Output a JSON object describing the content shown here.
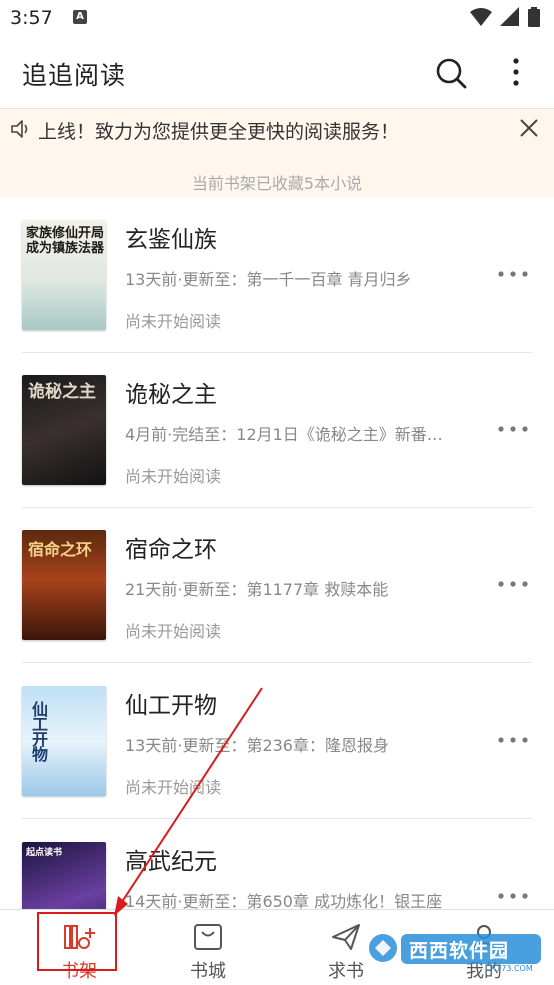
{
  "status_bar": {
    "time": "3:57",
    "badge": "A"
  },
  "app_bar": {
    "title": "追追阅读",
    "search_icon": "search-icon",
    "more_icon": "more-vert-icon"
  },
  "notice": {
    "text": "上线！致力为您提供更全更快的阅读服务！",
    "speaker_icon": "speaker-icon",
    "close_icon": "close-icon"
  },
  "shelf_count_text": "当前书架已收藏5本小说",
  "books": [
    {
      "title": "玄鉴仙族",
      "latest": "13天前·更新至：第一千一百章 青月归乡",
      "progress": "尚未开始阅读",
      "cover_text": "家族修仙开局成为镇族法器"
    },
    {
      "title": "诡秘之主",
      "latest": "4月前·完结至：12月1日《诡秘之主》新番…",
      "progress": "尚未开始阅读",
      "cover_text": "诡秘之主"
    },
    {
      "title": "宿命之环",
      "latest": "21天前·更新至：第1177章 救赎本能",
      "progress": "尚未开始阅读",
      "cover_text": "宿命之环"
    },
    {
      "title": "仙工开物",
      "latest": "13天前·更新至：第236章：隆恩报身",
      "progress": "尚未开始阅读",
      "cover_text": "仙工开物"
    },
    {
      "title": "高武纪元",
      "latest": "14天前·更新至：第650章 成功炼化！银王座",
      "progress": "",
      "cover_text": "起点读书"
    }
  ],
  "bottom_nav": [
    {
      "label": "书架",
      "icon": "bookshelf-icon",
      "active": true
    },
    {
      "label": "书城",
      "icon": "store-bag-icon",
      "active": false
    },
    {
      "label": "求书",
      "icon": "send-request-icon",
      "active": false
    },
    {
      "label": "我的",
      "icon": "profile-icon",
      "active": false
    }
  ],
  "watermark": {
    "text": "西西软件园",
    "sub": "CR173.COM"
  },
  "colors": {
    "accent": "#d93a2b",
    "annotation": "#d81c1c",
    "notice_bg": "#fff7ee"
  }
}
